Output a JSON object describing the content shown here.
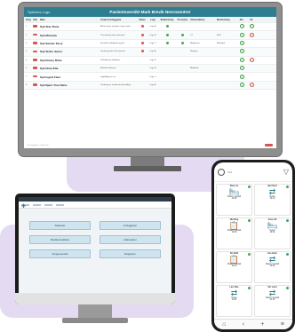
{
  "tv": {
    "logo": "Sykehus Logo",
    "title": "Pasientoversikt Mark Brevik Nevrosentrer",
    "headers": {
      "bed": "Seng",
      "flag": "Vakt",
      "name": "Navn",
      "reason": "Årsak til innleggelse",
      "status": "Status",
      "md": "Lege",
      "med": "Medisinering",
      "prio": "Prosedyre",
      "res": "Undersøkelser",
      "mon": "Monitorering",
      "dot": "Bet.",
      "end": "Utr."
    },
    "rows": [
      {
        "bed": "1",
        "name": "Syk Stav Dane",
        "reason": "Akutt smerte og feber i høyre hofte",
        "md": "Lege A",
        "res": "",
        "mon": ""
      },
      {
        "bed": "2",
        "name": "Syk Mina Ida",
        "reason": "Overvåkning etter operasjon",
        "md": "Lege B",
        "res": "CT",
        "mon": "EKG"
      },
      {
        "bed": "3",
        "name": "Syk Sander Perry",
        "reason": "Kontroll av blodtrykk og puls",
        "md": "Lege C",
        "res": "Blodprøver",
        "mon": "Blodtrykk"
      },
      {
        "bed": "4",
        "name": "Syk Stolin Junior",
        "reason": "Vurdering etter fall i hjemmet",
        "md": "Lege A",
        "res": "Røntgen",
        "mon": ""
      },
      {
        "bed": "5",
        "name": "Syk Ronny Rubo",
        "reason": "Utredning av hodepine",
        "md": "Lege D",
        "res": "",
        "mon": ""
      },
      {
        "bed": "6",
        "name": "Syk Nova Elia",
        "reason": "Mistenkt infeksjon",
        "md": "Lege B",
        "res": "Blodkultur",
        "mon": ""
      },
      {
        "bed": "7",
        "name": "Syk Ingrid Fleer",
        "reason": "Oppfølging av sår",
        "md": "Lege C",
        "res": "",
        "mon": ""
      },
      {
        "bed": "8",
        "name": "Syk Bjørn Tine Betto",
        "reason": "Vurdering av medisinsk behandling",
        "md": "Lege A",
        "res": "",
        "mon": ""
      }
    ],
    "footer": "Sist oppdatert: i dag 12:00"
  },
  "monitor": {
    "buttons": [
      "Pasienter",
      "Innleggelser",
      "Medikamentlister",
      "Utskrivelser",
      "Sengeoversikt",
      "Rapporter"
    ]
  },
  "phone": {
    "search_placeholder": "Søk",
    "cards": [
      {
        "name": "Stein Lie",
        "status": "Pasient mottatt",
        "time": "10:05"
      },
      {
        "name": "Kari Nord",
        "status": "Venter",
        "time": "10:12"
      },
      {
        "name": "Ola Berg",
        "status": "Pasient mottatt",
        "time": "10:20"
      },
      {
        "name": "Anne Vik",
        "status": "Venter",
        "time": "10:31"
      },
      {
        "name": "Per Dahl",
        "status": "Pasient mottatt",
        "time": "10:44"
      },
      {
        "name": "Eva Holm",
        "status": "Pasient mottatt",
        "time": "10:52"
      },
      {
        "name": "Lars Moe",
        "status": "Venter",
        "time": "11:04"
      },
      {
        "name": "Siri Lund",
        "status": "Pasient mottatt",
        "time": "11:15"
      }
    ],
    "nav": [
      "⌂",
      "‹",
      "+",
      "≡"
    ]
  }
}
